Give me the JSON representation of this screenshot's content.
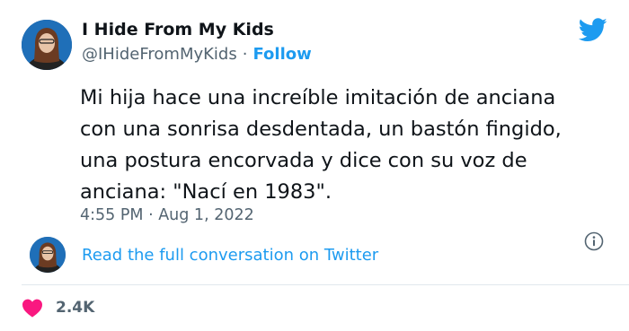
{
  "author": {
    "display_name": "I Hide From My Kids",
    "handle": "@IHideFromMyKids",
    "separator": "·",
    "follow_label": "Follow"
  },
  "tweet": {
    "lines": [
      "Mi hija hace una increíble imitación de anciana",
      "con una sonrisa desdentada, un bastón fingido,",
      "una postura encorvada y dice con su voz de",
      "anciana: \"Nací en 1983\"."
    ],
    "timestamp": "4:55 PM · Aug 1, 2022"
  },
  "conversation_link": "Read the full conversation on Twitter",
  "likes": {
    "count": "2.4K"
  },
  "colors": {
    "accent": "#1d9bf0",
    "heart": "#f91880",
    "muted": "#536471",
    "text": "#0f1419"
  },
  "icons": {
    "brand": "twitter-bird-icon",
    "info": "info-icon",
    "like": "heart-icon"
  }
}
